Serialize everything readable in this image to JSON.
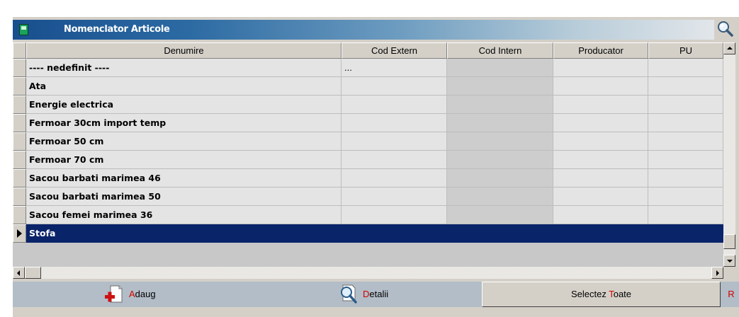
{
  "window": {
    "title": "Nomenclator Articole",
    "search_icon": "magnifier-icon"
  },
  "grid": {
    "columns": [
      "Denumire",
      "Cod Extern",
      "Cod Intern",
      "Producator",
      "PU"
    ],
    "rows": [
      {
        "denumire": "---- nedefinit ----",
        "cod_extern": "...",
        "cod_intern": "",
        "producator": "",
        "pu": ""
      },
      {
        "denumire": "Ata",
        "cod_extern": "",
        "cod_intern": "",
        "producator": "",
        "pu": ""
      },
      {
        "denumire": "Energie electrica",
        "cod_extern": "",
        "cod_intern": "",
        "producator": "",
        "pu": ""
      },
      {
        "denumire": "Fermoar 30cm import temp",
        "cod_extern": "",
        "cod_intern": "",
        "producator": "",
        "pu": ""
      },
      {
        "denumire": "Fermoar 50 cm",
        "cod_extern": "",
        "cod_intern": "",
        "producator": "",
        "pu": ""
      },
      {
        "denumire": "Fermoar 70 cm",
        "cod_extern": "",
        "cod_intern": "",
        "producator": "",
        "pu": ""
      },
      {
        "denumire": "Sacou barbati marimea 46",
        "cod_extern": "",
        "cod_intern": "",
        "producator": "",
        "pu": ""
      },
      {
        "denumire": "Sacou barbati marimea 50",
        "cod_extern": "",
        "cod_intern": "",
        "producator": "",
        "pu": ""
      },
      {
        "denumire": "Sacou femei marimea 36",
        "cod_extern": "",
        "cod_intern": "",
        "producator": "",
        "pu": ""
      },
      {
        "denumire": "Stofa",
        "cod_extern": "",
        "cod_intern": "",
        "producator": "",
        "pu": ""
      }
    ],
    "selected_row": 9
  },
  "toolbar": {
    "add": {
      "hotkey": "A",
      "rest": "daug",
      "icon": "add-document-icon"
    },
    "details": {
      "hotkey": "D",
      "rest": "etalii",
      "icon": "magnify-document-icon"
    },
    "select_all": {
      "before": "Selectez ",
      "hotkey": "T",
      "after": "oate"
    },
    "extra": "R"
  },
  "colors": {
    "selection": "#0a246a",
    "hotkey": "#d40000",
    "toolbar_bg": "#b2bdc7",
    "title_bar": "#184f8e"
  }
}
